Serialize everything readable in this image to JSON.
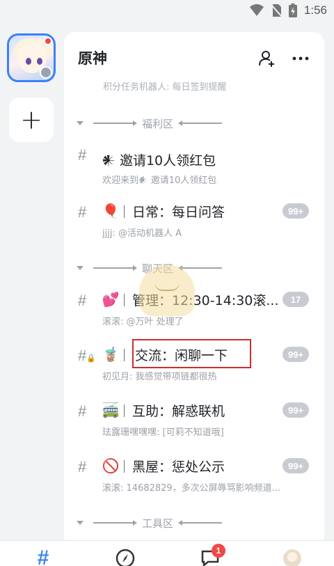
{
  "status_bar": {
    "time": "1:56"
  },
  "server_rail": {
    "add_label": "+"
  },
  "panel": {
    "title": "原神",
    "faded_text": "积分任务机器人: 每日签到提醒"
  },
  "categories": [
    {
      "label": "福利区"
    },
    {
      "label": "聊天区"
    },
    {
      "label": "工具区"
    }
  ],
  "channels": [
    {
      "emoji": "",
      "name": "𒀭 邀请10人领红包",
      "sub": "欢迎来到𒀭 邀请10人领红包",
      "badge": ""
    },
    {
      "emoji": "🎈",
      "name": "日常：每日问答",
      "sub": "jjjj: @活动机器人 A",
      "badge": "99+"
    },
    {
      "emoji": "💕",
      "name": "管理：12:30-14:30滚...",
      "sub": "滚滚: @万叶 处理了",
      "badge": "17"
    },
    {
      "emoji": "🧋",
      "name": "交流：闲聊一下",
      "sub": "初见月: 我感觉带项链都很热",
      "badge": "99+"
    },
    {
      "emoji": "🚎",
      "name": "互助：解惑联机",
      "sub": "珐露珊嘿嘿嘿: [可莉不知道哦]",
      "badge": "99+"
    },
    {
      "emoji": "🚫",
      "name": "黑屋：惩处公示",
      "sub": "滚滚: 14682829，多次公屏辱骂影响频道...",
      "badge": "99+"
    }
  ],
  "tabbar": {
    "messages_badge": "1"
  },
  "colors": {
    "accent": "#3b82f6",
    "badge_gray": "#c8ccd2",
    "highlight_red": "#d12b2b",
    "notification_red": "#f04848"
  }
}
